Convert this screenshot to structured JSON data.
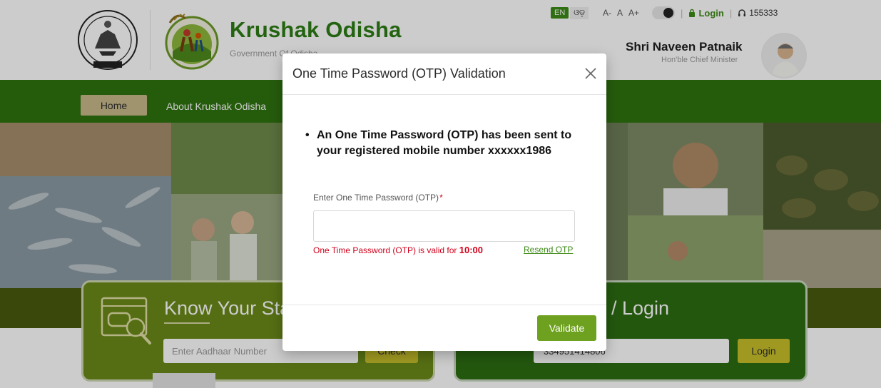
{
  "header": {
    "brand_title": "Krushak Odisha",
    "brand_subtitle": "Government Of Odisha",
    "emblem_seal_text": "Odisha Sarkar",
    "topbar": {
      "lang_en": "EN",
      "lang_od": "ଓଡ଼",
      "font_decrease": "A-",
      "font_normal": "A",
      "font_increase": "A+",
      "login_label": "Login",
      "helpline": "155333"
    },
    "cm_name": "Shri Naveen Patnaik",
    "cm_title": "Hon'ble Chief Minister"
  },
  "nav": {
    "home": "Home",
    "about": "About Krushak Odisha"
  },
  "cards": {
    "left_title": "Know Your Sta",
    "aadhaar_placeholder": "Enter Aadhaar Number",
    "check_label": "Check",
    "right_title": "/ Login",
    "registration_value": "334951414806",
    "login_label": "Login"
  },
  "modal": {
    "title": "One Time Password (OTP) Validation",
    "message": "An One Time Password (OTP) has been sent to your registered mobile number xxxxxx1986",
    "otp_label": "Enter One Time Password (OTP)",
    "required_star": "*",
    "validity_prefix": "One Time Password (OTP) is valid for ",
    "timer": "10:00",
    "resend_label": "Resend OTP",
    "validate_label": "Validate"
  },
  "colors": {
    "brand_green": "#2e7d16",
    "nav_green": "#2f7410",
    "validate_green": "#6ea11f",
    "error_red": "#d0021b",
    "button_yellow": "#c9c02a"
  },
  "icons": [
    "emblem-icon",
    "krushak-logo-icon",
    "lock-icon",
    "headset-icon",
    "search-window-icon",
    "close-icon"
  ]
}
